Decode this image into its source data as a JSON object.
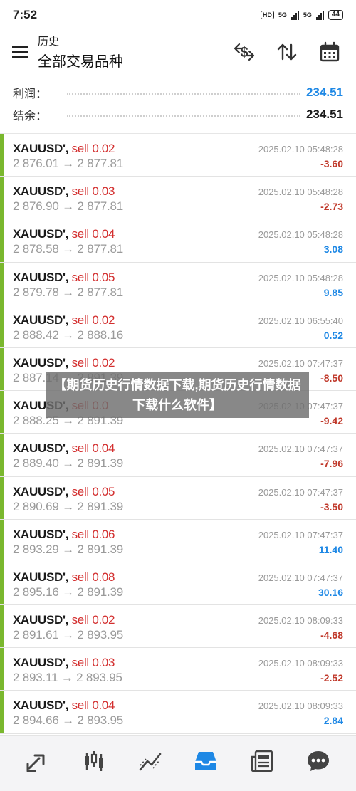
{
  "status": {
    "time": "7:52",
    "net1": "HD",
    "net2": "5G",
    "net3": "5G",
    "battery": "44"
  },
  "header": {
    "title_small": "历史",
    "title_large": "全部交易品种"
  },
  "icons": {
    "menu": "menu-icon",
    "currency": "currency-exchange-icon",
    "sort": "sort-icon",
    "calendar": "calendar-icon"
  },
  "summary": {
    "profit_label": "利润：",
    "profit_value": "234.51",
    "profit_color": "#1e88e5",
    "balance_label": "结余：",
    "balance_value": "234.51"
  },
  "trades": [
    {
      "symbol": "XAUUSD',",
      "side": "sell 0.02",
      "open": "2 876.01",
      "close": "2 877.81",
      "time": "2025.02.10 05:48:28",
      "pnl": "-3.60",
      "neg": true
    },
    {
      "symbol": "XAUUSD',",
      "side": "sell 0.03",
      "open": "2 876.90",
      "close": "2 877.81",
      "time": "2025.02.10 05:48:28",
      "pnl": "-2.73",
      "neg": true
    },
    {
      "symbol": "XAUUSD',",
      "side": "sell 0.04",
      "open": "2 878.58",
      "close": "2 877.81",
      "time": "2025.02.10 05:48:28",
      "pnl": "3.08",
      "neg": false
    },
    {
      "symbol": "XAUUSD',",
      "side": "sell 0.05",
      "open": "2 879.78",
      "close": "2 877.81",
      "time": "2025.02.10 05:48:28",
      "pnl": "9.85",
      "neg": false
    },
    {
      "symbol": "XAUUSD',",
      "side": "sell 0.02",
      "open": "2 888.42",
      "close": "2 888.16",
      "time": "2025.02.10 06:55:40",
      "pnl": "0.52",
      "neg": false
    },
    {
      "symbol": "XAUUSD',",
      "side": "sell 0.02",
      "open": "2 887.14",
      "close": "2 891.39",
      "time": "2025.02.10 07:47:37",
      "pnl": "-8.50",
      "neg": true
    },
    {
      "symbol": "XAUUSD',",
      "side": "sell 0.0",
      "open": "2 888.25",
      "close": "2 891.39",
      "time": "2025.02.10 07:47:37",
      "pnl": "-9.42",
      "neg": true
    },
    {
      "symbol": "XAUUSD',",
      "side": "sell 0.04",
      "open": "2 889.40",
      "close": "2 891.39",
      "time": "2025.02.10 07:47:37",
      "pnl": "-7.96",
      "neg": true
    },
    {
      "symbol": "XAUUSD',",
      "side": "sell 0.05",
      "open": "2 890.69",
      "close": "2 891.39",
      "time": "2025.02.10 07:47:37",
      "pnl": "-3.50",
      "neg": true
    },
    {
      "symbol": "XAUUSD',",
      "side": "sell 0.06",
      "open": "2 893.29",
      "close": "2 891.39",
      "time": "2025.02.10 07:47:37",
      "pnl": "11.40",
      "neg": false
    },
    {
      "symbol": "XAUUSD',",
      "side": "sell 0.08",
      "open": "2 895.16",
      "close": "2 891.39",
      "time": "2025.02.10 07:47:37",
      "pnl": "30.16",
      "neg": false
    },
    {
      "symbol": "XAUUSD',",
      "side": "sell 0.02",
      "open": "2 891.61",
      "close": "2 893.95",
      "time": "2025.02.10 08:09:33",
      "pnl": "-4.68",
      "neg": true
    },
    {
      "symbol": "XAUUSD',",
      "side": "sell 0.03",
      "open": "2 893.11",
      "close": "2 893.95",
      "time": "2025.02.10 08:09:33",
      "pnl": "-2.52",
      "neg": true
    },
    {
      "symbol": "XAUUSD',",
      "side": "sell 0.04",
      "open": "2 894.66",
      "close": "2 893.95",
      "time": "2025.02.10 08:09:33",
      "pnl": "2.84",
      "neg": false
    }
  ],
  "overlay": {
    "text": "【期货历史行情数据下载,期货历史行情数据下载什么软件】"
  },
  "bottom_nav": [
    {
      "icon": "trade-icon"
    },
    {
      "icon": "candlestick-chart-icon"
    },
    {
      "icon": "line-chart-icon"
    },
    {
      "icon": "history-inbox-icon",
      "active": true
    },
    {
      "icon": "news-icon"
    },
    {
      "icon": "chat-icon"
    }
  ],
  "colors": {
    "accent": "#1e88e5",
    "buy_bar": "#7ab82e",
    "loss": "#c0392b",
    "sell_text": "#d32f2f"
  }
}
